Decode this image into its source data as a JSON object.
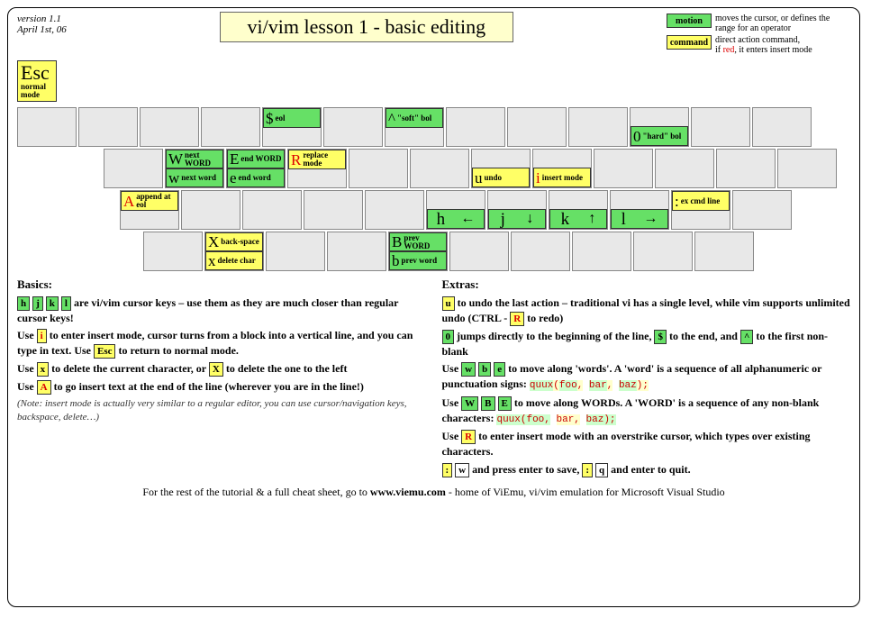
{
  "meta": {
    "version": "version 1.1",
    "date": "April 1st, 06"
  },
  "title": "vi/vim lesson 1 - basic editing",
  "legend": {
    "motion": {
      "label": "motion",
      "desc": "moves the cursor, or defines the range for an operator"
    },
    "command": {
      "label": "command",
      "desc_a": "direct action command,",
      "desc_b": "if ",
      "desc_red": "red",
      "desc_c": ", it enters insert mode"
    }
  },
  "esc": {
    "big": "Esc",
    "l1": "normal",
    "l2": "mode"
  },
  "keys": {
    "dollar": {
      "sym": "$",
      "lbl": "eol"
    },
    "caret": {
      "sym": "^",
      "lbl": "\"soft\" bol"
    },
    "zero": {
      "sym": "0",
      "lbl": "\"hard\" bol"
    },
    "W": {
      "sym": "W",
      "lbl": "next WORD"
    },
    "E": {
      "sym": "E",
      "lbl": "end WORD"
    },
    "R": {
      "sym": "R",
      "lbl": "replace mode"
    },
    "w": {
      "sym": "w",
      "lbl": "next word"
    },
    "e": {
      "sym": "e",
      "lbl": "end word"
    },
    "u": {
      "sym": "u",
      "lbl": "undo"
    },
    "i": {
      "sym": "i",
      "lbl": "insert mode"
    },
    "A": {
      "sym": "A",
      "lbl": "append at eol"
    },
    "colon": {
      "sym": ":",
      "lbl": "ex cmd line"
    },
    "h": {
      "sym": "h",
      "arrow": "←"
    },
    "j": {
      "sym": "j",
      "arrow": "↓"
    },
    "k": {
      "sym": "k",
      "arrow": "↑"
    },
    "l": {
      "sym": "l",
      "arrow": "→"
    },
    "X": {
      "sym": "X",
      "lbl": "back-space"
    },
    "x": {
      "sym": "x",
      "lbl": "delete char"
    },
    "B": {
      "sym": "B",
      "lbl": "prev WORD"
    },
    "b": {
      "sym": "b",
      "lbl": "prev word"
    }
  },
  "basics": {
    "hdr": "Basics:",
    "p1a": "are vi/vim cursor keys – use them as they are  much closer than regular cursor keys!",
    "p2a": "Use ",
    "p2b": " to enter insert mode, cursor turns from a block into a vertical line, and you can type in text. Use ",
    "p2c": " to  return to normal mode.",
    "p3a": "Use ",
    "p3b": " to delete the current character, or ",
    "p3c": " to delete the one to the left",
    "p4a": "Use ",
    "p4b": " to go insert text at the end of the line (wherever you are in the line!)",
    "note": "(Note: insert mode is actually very similar to a regular editor, you can use cursor/navigation keys, backspace,  delete…)"
  },
  "extras": {
    "hdr": "Extras:",
    "p1a": " to undo the last action – traditional vi has a single level, while vim supports unlimited undo (CTRL - ",
    "p1b": " to redo)",
    "p2a": " jumps directly to the beginning of the line, ",
    "p2b": " to the end, and ",
    "p2c": " to the first non-blank",
    "p3a": "Use ",
    "p3b": " to move along 'words'. A 'word' is a sequence of all alphanumeric or punctuation signs:  ",
    "p4a": "Use ",
    "p4b": " to move along WORDs. A 'WORD' is a sequence of any non-blank characters:   ",
    "p5a": "Use ",
    "p5b": " to enter insert mode with an overstrike cursor, which types over existing characters.",
    "p6a": " and press enter to save, ",
    "p6b": " and enter to quit."
  },
  "ik": {
    "h": "h",
    "j": "j",
    "k": "k",
    "l": "l",
    "i": "i",
    "Esc": "Esc",
    "x": "x",
    "X": "X",
    "A": "A",
    "u": "u",
    "R": "R",
    "0": "0",
    "dollar": "$",
    "caret": "^",
    "w": "w",
    "b": "b",
    "e": "e",
    "W": "W",
    "B": "B",
    "E": "E",
    "colon": ":",
    "q": "q"
  },
  "code1": {
    "a": "quux",
    "b": "(",
    "c": "foo",
    "d": ",",
    "sp": " ",
    "e": "bar",
    "f": ",",
    "g": "baz",
    "h": ")",
    "i": ";"
  },
  "code2": {
    "a": "quux(foo,",
    "sp": " ",
    "b": "bar,",
    "c": "baz);"
  },
  "footer": {
    "a": "For the rest of the tutorial & a full cheat sheet, go to ",
    "b": "www.viemu.com",
    "c": " - home of ViEmu, vi/vim emulation for Microsoft Visual Studio"
  }
}
